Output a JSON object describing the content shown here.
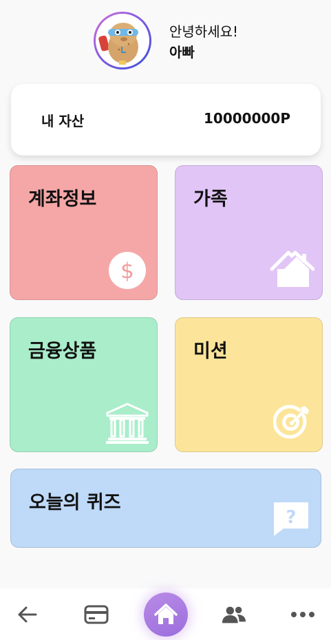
{
  "header": {
    "greeting": "안녕하세요!",
    "username": "아빠"
  },
  "asset": {
    "label": "내 자산",
    "value": "10000000P"
  },
  "tiles": {
    "account": {
      "title": "계좌정보",
      "icon": "dollar-coin-icon",
      "color": "#f5a7a7"
    },
    "family": {
      "title": "가족",
      "icon": "house-icon",
      "color": "#e1c5f6"
    },
    "finance": {
      "title": "금융상품",
      "icon": "bank-building-icon",
      "color": "#a9edca"
    },
    "mission": {
      "title": "미션",
      "icon": "target-icon",
      "color": "#fce59a"
    },
    "quiz": {
      "title": "오늘의 퀴즈",
      "icon": "question-bubble-icon",
      "color": "#bfd9f8"
    }
  },
  "nav": {
    "items": [
      "back-arrow-icon",
      "card-icon",
      "home-icon",
      "users-icon",
      "more-icon"
    ],
    "active_color": "#a67de2"
  }
}
